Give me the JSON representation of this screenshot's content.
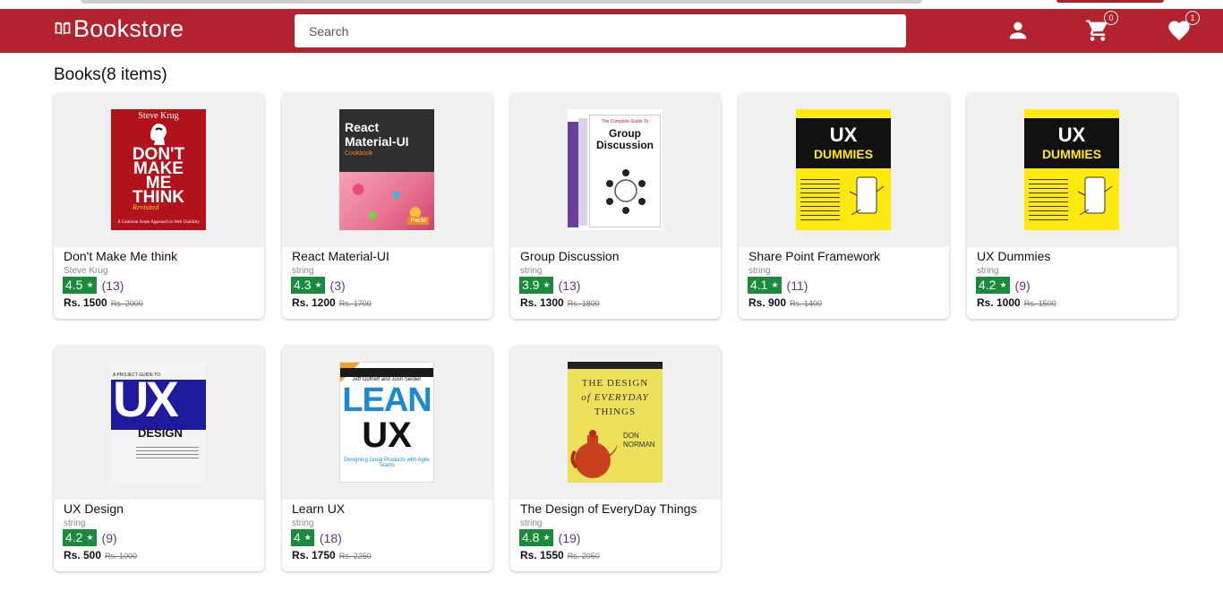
{
  "header": {
    "brand": "Bookstore",
    "search_placeholder": "Search",
    "cart_count": "0",
    "wishlist_count": "1"
  },
  "page_title": "Books(8 items)",
  "colors": {
    "header_bg": "#b3222f",
    "rating_bg": "#1a8a3b"
  },
  "books": [
    {
      "title": "Don't Make Me think",
      "author": "Steve Krug",
      "rating": "4.5",
      "reviews": "(13)",
      "price": "Rs. 1500",
      "old_price": "Rs. 2000"
    },
    {
      "title": "React Material-UI",
      "author": "string",
      "rating": "4.3",
      "reviews": "(3)",
      "price": "Rs. 1200",
      "old_price": "Rs. 1700"
    },
    {
      "title": "Group Discussion",
      "author": "string",
      "rating": "3.9",
      "reviews": "(13)",
      "price": "Rs. 1300",
      "old_price": "Rs. 1800"
    },
    {
      "title": "Share Point Framework",
      "author": "string",
      "rating": "4.1",
      "reviews": "(11)",
      "price": "Rs. 900",
      "old_price": "Rs. 1400"
    },
    {
      "title": "UX Dummies",
      "author": "string",
      "rating": "4.2",
      "reviews": "(9)",
      "price": "Rs. 1000",
      "old_price": "Rs. 1500"
    },
    {
      "title": "UX Design",
      "author": "string",
      "rating": "4.2",
      "reviews": "(9)",
      "price": "Rs. 500",
      "old_price": "Rs. 1000"
    },
    {
      "title": "Learn UX",
      "author": "string",
      "rating": "4",
      "reviews": "(18)",
      "price": "Rs. 1750",
      "old_price": "Rs. 2250"
    },
    {
      "title": "The Design of EveryDay Things",
      "author": "string",
      "rating": "4.8",
      "reviews": "(19)",
      "price": "Rs. 1550",
      "old_price": "Rs. 2050"
    }
  ],
  "covers": {
    "dmmt": {
      "author": "Steve Krug",
      "l1": "DON'T",
      "l2": "MAKE",
      "l3": "ME",
      "l4": "THINK",
      "tag": "Revisited",
      "sub": "A Common Sense Approach to Web Usability"
    },
    "react": {
      "l1": "React",
      "l2": "Material-UI",
      "l3": "Cookbook",
      "pub": "Packt"
    },
    "gd": {
      "top": "The Complete Guide To",
      "l1": "Group",
      "l2": "Discussion"
    },
    "ux": {
      "l1": "UX",
      "l2": "DUMMIES"
    },
    "uxd": {
      "top": "A PROJECT GUIDE TO",
      "l1": "UX",
      "l2": "DESIGN"
    },
    "lean": {
      "authors": "Jeff Gothelf and Josh Seiden",
      "l1": "LEAN",
      "l2": "UX",
      "sub": "Designing Great Products with Agile Teams"
    },
    "doet": {
      "l1": "THE DESIGN",
      "l2": "of EVERYDAY",
      "l3": "THINGS",
      "a1": "DON",
      "a2": "NORMAN"
    }
  }
}
